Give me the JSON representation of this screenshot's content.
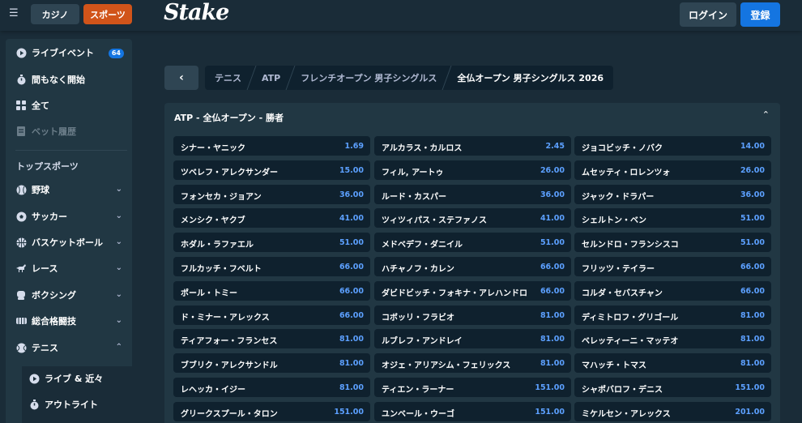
{
  "header": {
    "menu_icon": "hamburger-icon",
    "tabs": [
      {
        "label": "カジノ"
      },
      {
        "label": "スポーツ"
      }
    ],
    "logo": "Stake",
    "login": "ログイン",
    "register": "登録"
  },
  "sidebar": {
    "top_items": [
      {
        "label": "ライブイベント",
        "icon": "live-icon",
        "badge": "64"
      },
      {
        "label": "間もなく開始",
        "icon": "stopwatch-icon"
      },
      {
        "label": "全て",
        "icon": "grid-icon"
      },
      {
        "label": "ベット履歴",
        "icon": "betslip-icon"
      }
    ],
    "heading": "トップスポーツ",
    "sports": [
      {
        "label": "野球",
        "icon": "baseball-icon"
      },
      {
        "label": "サッカー",
        "icon": "soccer-icon"
      },
      {
        "label": "バスケットボール",
        "icon": "basketball-icon"
      },
      {
        "label": "レース",
        "icon": "racing-icon"
      },
      {
        "label": "ボクシング",
        "icon": "boxing-icon"
      },
      {
        "label": "総合格闘技",
        "icon": "mma-icon"
      },
      {
        "label": "テニス",
        "icon": "tennis-icon"
      }
    ],
    "tennis_sub": [
      {
        "label": "ライブ & 近々",
        "icon": "live-icon"
      },
      {
        "label": "アウトライト",
        "icon": "stopwatch-icon"
      }
    ]
  },
  "breadcrumb": [
    "テニス",
    "ATP",
    "フレンチオープン 男子シングルス",
    "全仏オープン 男子シングルス 2026"
  ],
  "market": {
    "title": "ATP - 全仏オープン - 勝者",
    "outcomes": [
      {
        "name": "シナー・ヤニック",
        "odds": "1.69"
      },
      {
        "name": "アルカラス・カルロス",
        "odds": "2.45"
      },
      {
        "name": "ジョコビッチ・ノバク",
        "odds": "14.00"
      },
      {
        "name": "ツベレフ・アレクサンダー",
        "odds": "15.00"
      },
      {
        "name": "フィル, アートゥ",
        "odds": "26.00"
      },
      {
        "name": "ムセッティ・ロレンツォ",
        "odds": "26.00"
      },
      {
        "name": "フォンセカ・ジョアン",
        "odds": "36.00"
      },
      {
        "name": "ルード・カスパー",
        "odds": "36.00"
      },
      {
        "name": "ジャック・ドラパー",
        "odds": "36.00"
      },
      {
        "name": "メンシク・ヤクブ",
        "odds": "41.00"
      },
      {
        "name": "ツィツィパス・ステファノス",
        "odds": "41.00"
      },
      {
        "name": "シェルトン・ベン",
        "odds": "51.00"
      },
      {
        "name": "ホダル・ラファエル",
        "odds": "51.00"
      },
      {
        "name": "メドベデフ・ダニイル",
        "odds": "51.00"
      },
      {
        "name": "セルンドロ・フランシスコ",
        "odds": "51.00"
      },
      {
        "name": "フルカッチ・フベルト",
        "odds": "66.00"
      },
      {
        "name": "ハチャノフ・カレン",
        "odds": "66.00"
      },
      {
        "name": "フリッツ・テイラー",
        "odds": "66.00"
      },
      {
        "name": "ポール・トミー",
        "odds": "66.00"
      },
      {
        "name": "ダビドビッチ・フォキナ・アレハンドロ",
        "odds": "66.00"
      },
      {
        "name": "コルダ・セバスチャン",
        "odds": "66.00"
      },
      {
        "name": "ド・ミナー・アレックス",
        "odds": "66.00"
      },
      {
        "name": "コボッリ・フラビオ",
        "odds": "81.00"
      },
      {
        "name": "ディミトロフ・グリゴール",
        "odds": "81.00"
      },
      {
        "name": "ティアフォー・フランセス",
        "odds": "81.00"
      },
      {
        "name": "ルブレフ・アンドレイ",
        "odds": "81.00"
      },
      {
        "name": "ベレッティーニ・マッテオ",
        "odds": "81.00"
      },
      {
        "name": "ブブリク・アレクサンドル",
        "odds": "81.00"
      },
      {
        "name": "オジェ・アリアシム・フェリックス",
        "odds": "81.00"
      },
      {
        "name": "マハッチ・トマス",
        "odds": "81.00"
      },
      {
        "name": "レヘッカ・イジー",
        "odds": "81.00"
      },
      {
        "name": "ティエン・ラーナー",
        "odds": "151.00"
      },
      {
        "name": "シャポバロフ・デニス",
        "odds": "151.00"
      },
      {
        "name": "グリークスプール・タロン",
        "odds": "151.00"
      },
      {
        "name": "ユンベール・ウーゴ",
        "odds": "151.00"
      },
      {
        "name": "ミケルセン・アレックス",
        "odds": "201.00"
      }
    ]
  },
  "colors": {
    "accent": "#1475e1",
    "sports_tab": "#d1541a",
    "odds": "#5ca0ff",
    "bg": "#1a2c38",
    "panel": "#213743",
    "cell": "#0f212e"
  }
}
